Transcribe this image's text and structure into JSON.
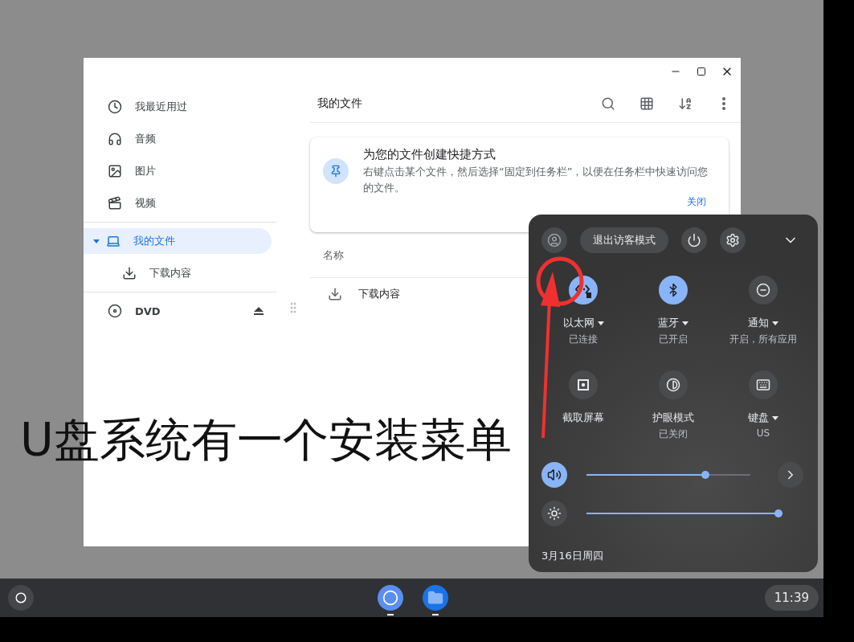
{
  "files_window": {
    "sidebar": {
      "items": [
        {
          "kind": "place",
          "label": "我最近用过",
          "selected": false
        },
        {
          "kind": "place",
          "label": "音频",
          "selected": false
        },
        {
          "kind": "place",
          "label": "图片",
          "selected": false
        },
        {
          "kind": "place",
          "label": "视频",
          "selected": false
        },
        {
          "kind": "tree",
          "label": "我的文件",
          "selected": true,
          "expanded": true,
          "children": [
            {
              "kind": "folder",
              "label": "下载内容",
              "selected": false
            }
          ]
        },
        {
          "kind": "device",
          "label": "DVD",
          "selected": false
        }
      ]
    },
    "title": "我的文件",
    "banner": {
      "title": "为您的文件创建快捷方式",
      "text": "右键点击某个文件，然后选择“固定到任务栏”，以便在任务栏中快速访问您的文件。",
      "link": "关闭"
    },
    "table": {
      "columns": [
        "名称"
      ],
      "rows": [
        {
          "name": "下载内容"
        }
      ]
    }
  },
  "annotation": {
    "caption": "U盘系统有一个安装菜单"
  },
  "quick_settings": {
    "guest_button": "退出访客模式",
    "tiles": [
      {
        "label": "以太网",
        "status": "已连接",
        "on": true,
        "menu": true
      },
      {
        "label": "蓝牙",
        "status": "已开启",
        "on": true,
        "menu": true
      },
      {
        "label": "通知",
        "status": "开启，所有应用",
        "on": false,
        "menu": true
      },
      {
        "label": "截取屏幕",
        "on": false
      },
      {
        "label": "护眼模式",
        "status": "已关闭",
        "on": false
      },
      {
        "label": "键盘",
        "status": "US",
        "on": false,
        "menu": true
      }
    ],
    "sliders": [
      {
        "kind": "volume",
        "level": 0.735,
        "on": true
      },
      {
        "kind": "brightness",
        "level": 1,
        "on": false
      }
    ],
    "date": "3月16日周四"
  },
  "shelf": {
    "apps": [
      {
        "kind": "browser",
        "running": true
      },
      {
        "kind": "files",
        "running": true
      }
    ],
    "clock": "11:39"
  }
}
